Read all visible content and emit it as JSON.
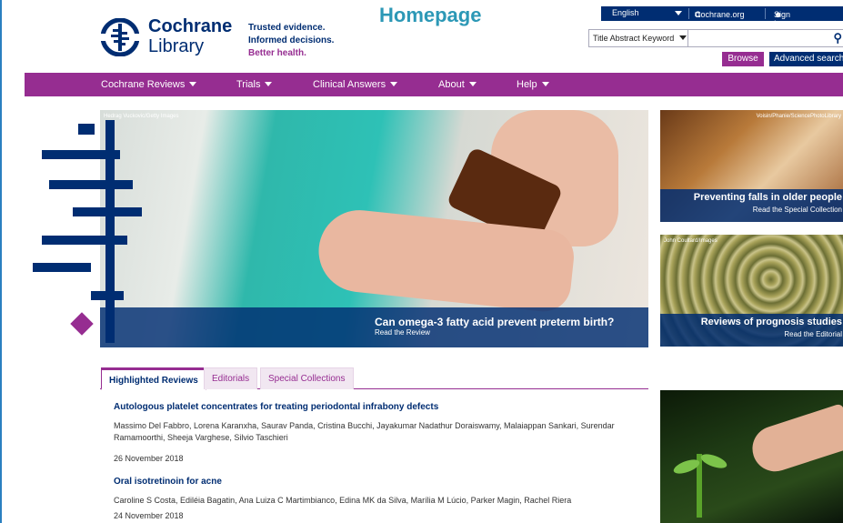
{
  "page_label": "Homepage",
  "logo": {
    "line1": "Cochrane",
    "line2": "Library"
  },
  "tagline": {
    "line1": "Trusted evidence.",
    "line2": "Informed decisions.",
    "line3": "Better health."
  },
  "topbar": {
    "language": "English",
    "cochrane_link": "Cochrane.org",
    "sign_in": "Sign In"
  },
  "search": {
    "type_selected": "Title Abstract Keyword",
    "value": ""
  },
  "buttons": {
    "browse": "Browse",
    "advanced": "Advanced search"
  },
  "nav": [
    {
      "label": "Cochrane Reviews"
    },
    {
      "label": "Trials"
    },
    {
      "label": "Clinical Answers"
    },
    {
      "label": "About"
    },
    {
      "label": "Help"
    }
  ],
  "hero": {
    "credit": "Hedrag Vuckovic/Getty Images",
    "title": "Can omega-3 fatty acid prevent preterm birth?",
    "subtitle": "Read the Review"
  },
  "side_cards": [
    {
      "credit": "Voisin/Phanie/SciencePhotoLibrary",
      "title": "Preventing falls in older people",
      "subtitle": "Read the Special Collection"
    },
    {
      "credit": "John Coultard/Images",
      "title": "Reviews of prognosis studies",
      "subtitle": "Read the Editorial"
    }
  ],
  "tabs": [
    {
      "label": "Highlighted Reviews"
    },
    {
      "label": "Editorials"
    },
    {
      "label": "Special Collections"
    }
  ],
  "articles": [
    {
      "title": "Autologous platelet concentrates for treating periodontal infrabony defects",
      "authors": "Massimo Del Fabbro, Lorena Karanxha, Saurav Panda, Cristina Bucchi, Jayakumar Nadathur Doraiswamy, Malaiappan Sankari, Surendar Ramamoorthi, Sheeja Varghese, Silvio Taschieri",
      "date": "26 November 2018"
    },
    {
      "title": "Oral isotretinoin for acne",
      "authors": "Caroline S Costa, Ediléia Bagatin, Ana Luiza C Martimbianco, Edina MK da Silva, Marília M Lúcio, Parker Magin, Rachel Riera",
      "date": "24 November 2018"
    }
  ],
  "colors": {
    "navy": "#002d72",
    "purple": "#962d91",
    "label": "#2c98b6"
  }
}
